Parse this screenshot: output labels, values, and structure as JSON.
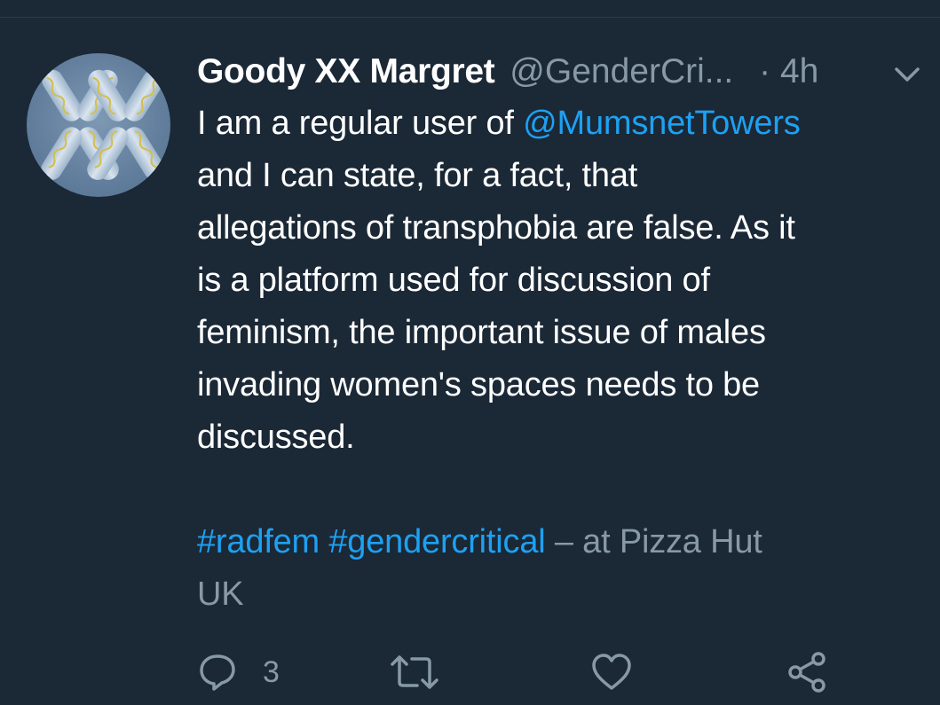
{
  "tweet": {
    "display_name": "Goody XX Margret",
    "handle": "@GenderCri...",
    "separator": "·",
    "time": "4h",
    "body": {
      "line1_prefix": "I am a regular user of ",
      "mention": "@MumsnetTowers",
      "line2": "and I can state, for a fact, that",
      "line3": "allegations of transphobia are false. As it",
      "line4": "is a platform used for discussion of",
      "line5": "feminism, the important issue of males",
      "line6": "invading women's spaces needs to be",
      "line7": "discussed."
    },
    "hashtag1": "#radfem",
    "hashtag2": "#gendercritical",
    "location_prefix": " – at Pizza Hut",
    "location_suffix": "UK"
  },
  "actions": {
    "reply_count": "3",
    "icons": [
      "reply-icon",
      "retweet-icon",
      "like-icon",
      "share-icon"
    ]
  },
  "colors": {
    "background": "#1b2836",
    "text": "#ffffff",
    "muted": "#8899a6",
    "accent": "#1da1f2"
  }
}
